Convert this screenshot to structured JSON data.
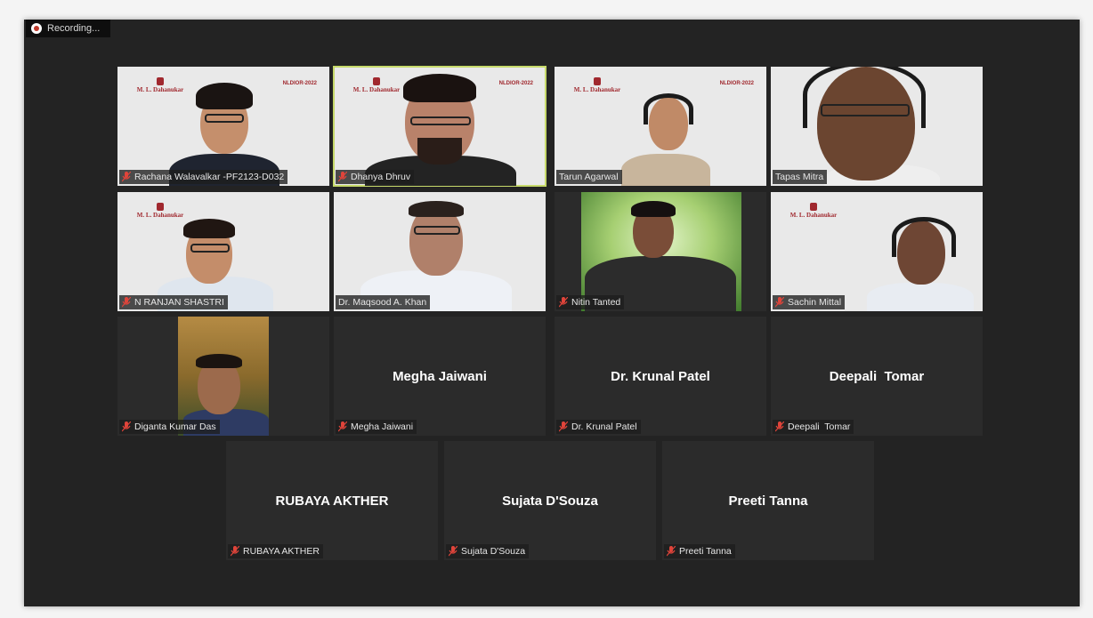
{
  "recording": {
    "label": "Recording..."
  },
  "video_tiles": [
    {
      "name": "Rachana Walavalkar -PF2123-D032",
      "brand": "M. L. Dahanukar",
      "brand_right": "NLDIOR-2022"
    },
    {
      "name": "Dhanya Dhruv",
      "brand": "M. L. Dahanukar",
      "brand_right": "NLDIOR-2022"
    },
    {
      "name": "Tarun Agarwal",
      "brand": "M. L. Dahanukar",
      "brand_right": "NLDIOR-2022"
    },
    {
      "name": "Tapas Mitra"
    },
    {
      "name": "N RANJAN SHASTRI",
      "brand": "M. L. Dahanukar"
    },
    {
      "name": "Dr. Maqsood A. Khan"
    },
    {
      "name": "Nitin Tanted"
    },
    {
      "name": "Sachin Mittal",
      "brand": "M. L. Dahanukar"
    },
    {
      "name": "Diganta Kumar Das"
    }
  ],
  "name_tiles": [
    {
      "center": "Megha Jaiwani",
      "tag": "Megha Jaiwani"
    },
    {
      "center": "Dr. Krunal Patel",
      "tag": "Dr. Krunal Patel"
    },
    {
      "center": "Deepali  Tomar",
      "tag": "Deepali  Tomar"
    },
    {
      "center": "RUBAYA AKTHER",
      "tag": "RUBAYA AKTHER"
    },
    {
      "center": "Sujata D'Souza",
      "tag": "Sujata D'Souza"
    },
    {
      "center": "Preeti Tanna",
      "tag": "Preeti Tanna"
    }
  ],
  "colors": {
    "background": "#232323",
    "tile": "#2b2b2b",
    "mic_muted": "#e0443a",
    "active_speaker": "#c6d96a"
  },
  "icons": {
    "recording": "record-icon",
    "mic": "mic-muted-icon"
  }
}
